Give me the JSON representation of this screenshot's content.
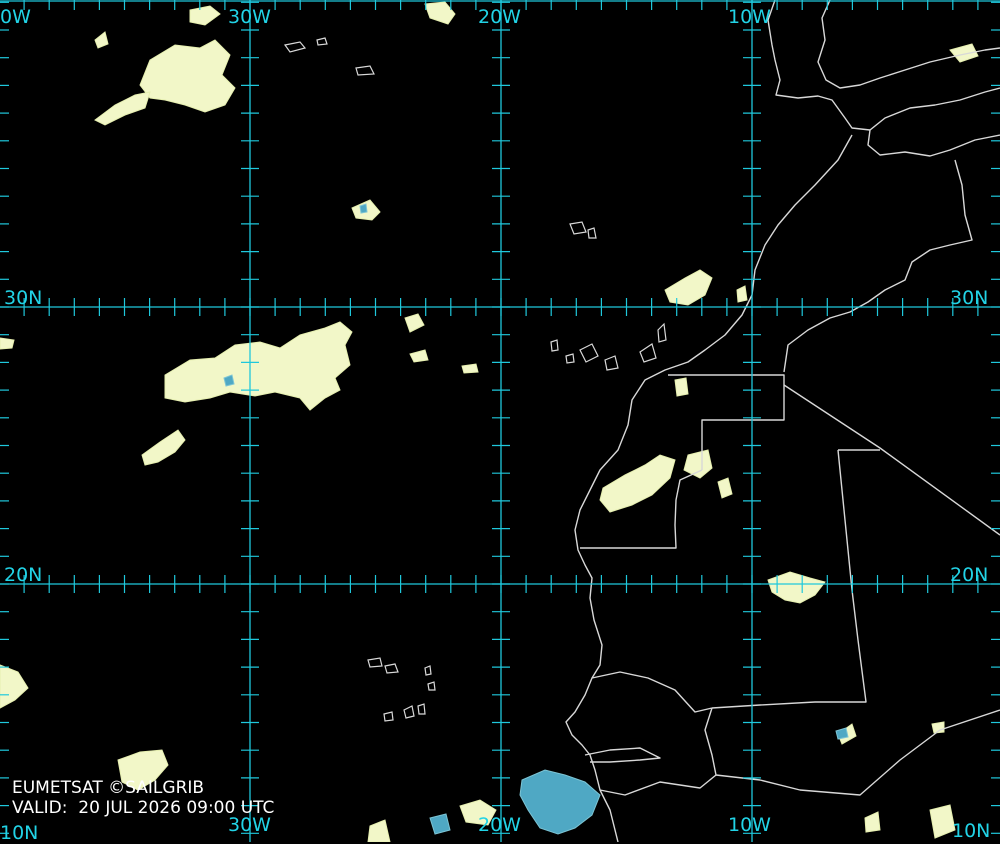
{
  "map": {
    "type": "satellite-cloud-image",
    "colors": {
      "background": "#000000",
      "grid": "#1fc8dc",
      "grid_label": "#22d3e6",
      "coastline": "#d8d8d8",
      "cloud_bright": "#f2f7c8",
      "cloud_cold": "#4fa8c4",
      "credit_text": "#ffffff"
    },
    "grid": {
      "longitudes": [
        "30W",
        "20W",
        "10W"
      ],
      "latitudes": [
        "30N",
        "20N"
      ],
      "labels": {
        "top_edge_left": "0W",
        "top_30w": "30W",
        "top_20w": "20W",
        "top_10w": "10W",
        "left_30n": "30N",
        "right_30n": "30N",
        "left_20n": "20N",
        "right_20n": "20N",
        "bottom_edge_left": "10N",
        "bottom_30w": "30W",
        "bottom_20w": "20W",
        "bottom_10w": "10W",
        "bottom_right": "10N"
      }
    },
    "credit": {
      "source": "EUMETSAT ©SAILGRIB",
      "valid": "VALID:  20 JUL 2026 09:00 UTC"
    }
  }
}
